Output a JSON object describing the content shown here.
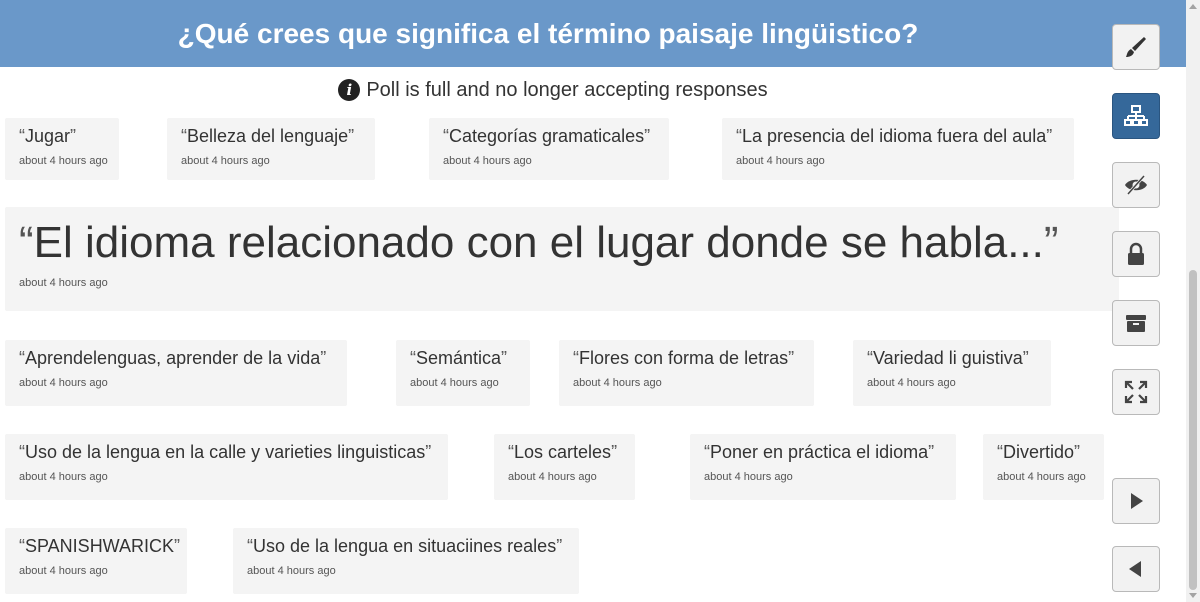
{
  "header": {
    "title": "¿Qué crees que significa el término paisaje lingüistico?"
  },
  "notice": {
    "icon": "info-icon",
    "text": "Poll is full and no longer accepting responses"
  },
  "quote_open": "“",
  "quote_close": "”",
  "responses": [
    {
      "text": "Jugar",
      "time": "about 4 hours ago"
    },
    {
      "text": "Belleza del lenguaje",
      "time": "about 4 hours ago"
    },
    {
      "text": "Categorías gramaticales",
      "time": "about 4 hours ago"
    },
    {
      "text": "La presencia del idioma fuera del aula",
      "time": "about 4 hours ago"
    },
    {
      "text": "El idioma relacionado con el lugar donde se habla...",
      "time": "about 4 hours ago"
    },
    {
      "text": "Aprendelenguas, aprender de la vida",
      "time": "about 4 hours ago"
    },
    {
      "text": "Semántica",
      "time": "about 4 hours ago"
    },
    {
      "text": "Flores con forma de letras",
      "time": "about 4 hours ago"
    },
    {
      "text": "Variedad li guistiva",
      "time": "about 4 hours ago"
    },
    {
      "text": "Uso de la lengua en la calle y varieties linguisticas",
      "time": "about 4 hours ago"
    },
    {
      "text": "Los carteles",
      "time": "about 4 hours ago"
    },
    {
      "text": "Poner en práctica el idioma",
      "time": "about 4 hours ago"
    },
    {
      "text": "Divertido",
      "time": "about 4 hours ago"
    },
    {
      "text": "SPANISHWARICK",
      "time": "about 4 hours ago"
    },
    {
      "text": "Uso de la lengua en situaciines reales",
      "time": "about 4 hours ago"
    }
  ],
  "sidebar": [
    {
      "icon": "paintbrush-icon",
      "active": false
    },
    {
      "icon": "hierarchy-icon",
      "active": true
    },
    {
      "icon": "eye-slash-icon",
      "active": false
    },
    {
      "icon": "lock-icon",
      "active": false
    },
    {
      "icon": "archive-icon",
      "active": false
    },
    {
      "icon": "fullscreen-icon",
      "active": false
    },
    {
      "icon": "play-next-icon",
      "active": false
    },
    {
      "icon": "play-previous-icon",
      "active": false
    }
  ],
  "colors": {
    "header_bg": "#6a98c9",
    "active_button": "#35689a",
    "card_bg": "#f4f4f4"
  }
}
